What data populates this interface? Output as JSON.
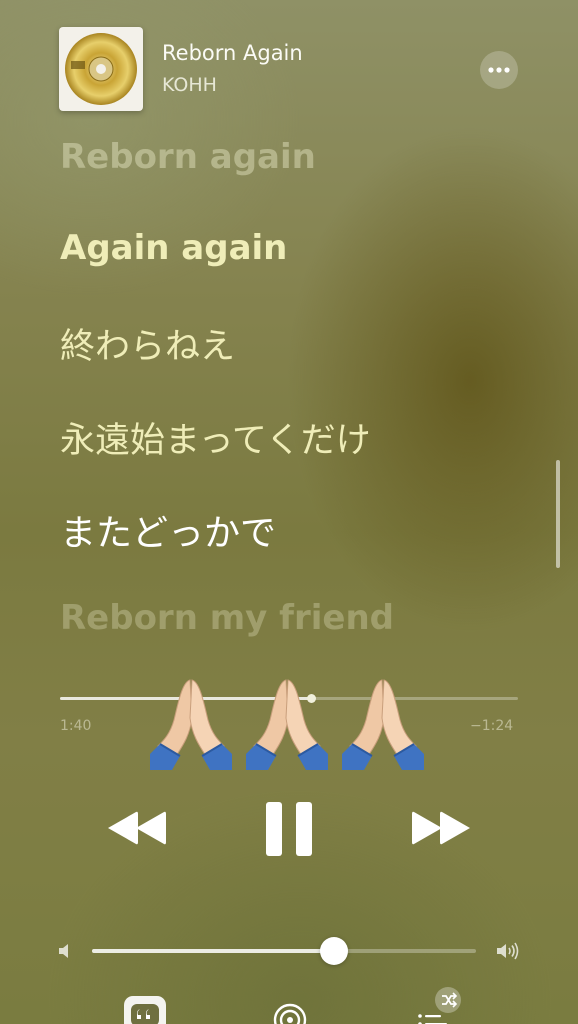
{
  "now_playing": {
    "title": "Reborn Again",
    "artist": "KOHH",
    "album_art_icon": "golden-cd-disc"
  },
  "more_icon": "ellipsis-icon",
  "lyrics": {
    "lines": [
      "Reborn again",
      "Again again",
      "終わらねえ",
      "永遠始まってくだけ",
      "またどっかで",
      "Reborn my friend"
    ],
    "current_index": 4
  },
  "playback": {
    "elapsed": "1:40",
    "remaining": "−1:24",
    "progress": 0.55,
    "state": "playing"
  },
  "overlay_emoji": "🙏🏼🙏🏼🙏🏼",
  "volume": {
    "level": 0.63
  },
  "toolbar": {
    "lyrics_icon": "quote-bubble-icon",
    "airplay_icon": "airplay-audio-icon",
    "queue_icon": "queue-list-icon",
    "shuffle_icon": "shuffle-icon"
  },
  "colors": {
    "background": "#85834f",
    "lyric_active": "#ffffff",
    "lyric_upcoming": "#efedb8"
  }
}
